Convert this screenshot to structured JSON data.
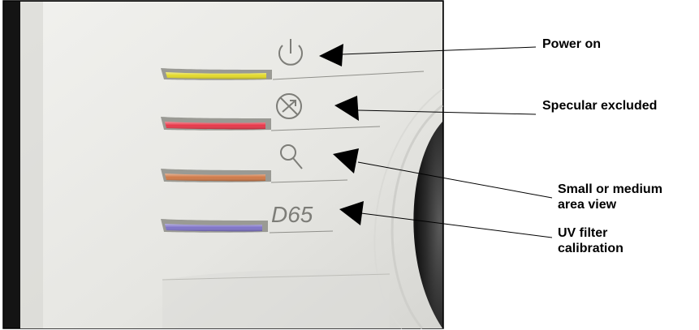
{
  "panel": {
    "d65_text": "D65",
    "leds": [
      {
        "name": "power",
        "color": "#e3d92a"
      },
      {
        "name": "specular",
        "color": "#e8384a"
      },
      {
        "name": "area",
        "color": "#d07a48"
      },
      {
        "name": "uv",
        "color": "#7f74c8"
      }
    ]
  },
  "callouts": {
    "power": "Power on",
    "specular": "Specular excluded",
    "area_line1": "Small or medium",
    "area_line2": "area view",
    "uv_line1": "UV filter",
    "uv_line2": "calibration"
  }
}
